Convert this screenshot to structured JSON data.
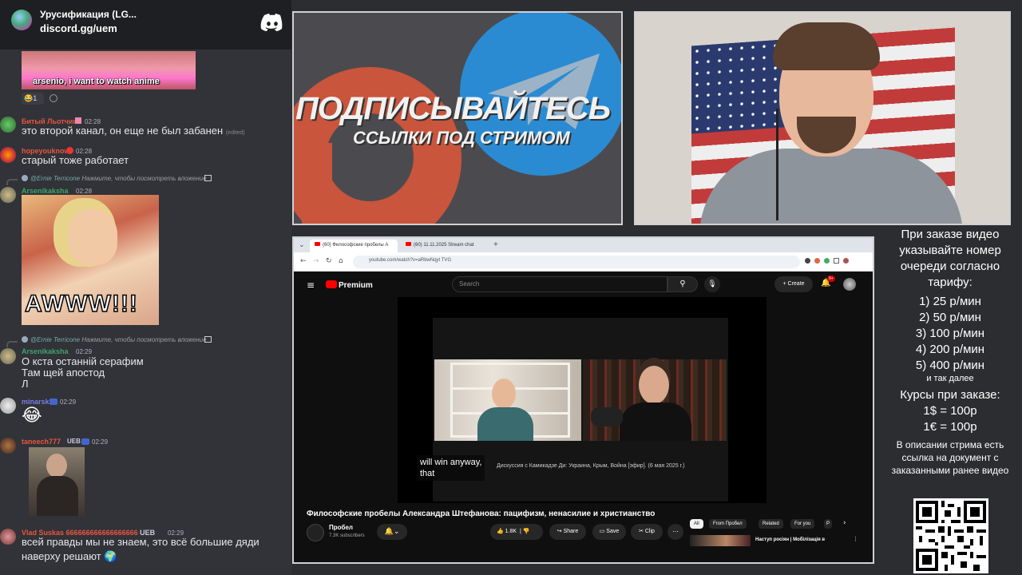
{
  "chat": {
    "server_name": "Урусификация (LG...",
    "server_link": "discord.gg/uem",
    "gif1_caption": "arsenio, i want to watch anime",
    "reaction_count": "1",
    "messages": [
      {
        "name": "Битый Льотчик",
        "time": "02:28",
        "text": "это второй канал, он еще не был забанен",
        "suffix": "(edited)"
      },
      {
        "name": "hopeyouknow",
        "time": "02:28",
        "text": "старый тоже работает"
      },
      {
        "reply": "@Ernie Terricone",
        "reply_text": "Нажмите, чтобы посмотреть вложение",
        "name": "Arsenikaksha",
        "time": "02:28",
        "gif_caption": "AWWW!!!"
      },
      {
        "reply": "@Ernie Terricone",
        "reply_text": "Нажмите, чтобы посмотреть вложение",
        "name": "Arsenikaksha",
        "time": "02:29",
        "lines": [
          "О кста останній серафим",
          "Там щей апостод",
          "Л"
        ]
      },
      {
        "name": "minarski",
        "time": "02:29",
        "emoji": "😂"
      },
      {
        "name": "taneech777",
        "badge": "UEB",
        "time": "02:29"
      },
      {
        "name": "Vlad Suskas",
        "extra": "666666666666666666",
        "badge": "UEB",
        "time": "02:29",
        "lines": [
          "всей правды мы не знаем, это всё большие дяди",
          "наверху решают"
        ]
      }
    ]
  },
  "promo": {
    "headline": "ПОДПИСЫВАЙТЕСЬ",
    "subline": "ССЫЛКИ ПОД СТРИМОМ"
  },
  "browser": {
    "tabs": [
      "(60) Философские пробелы А",
      "(60) 11.11.2025 Stream chat"
    ],
    "url": "youtube.com/watch?v=aRbwNqyt TVG",
    "yt_logo": "Premium",
    "search_placeholder": "Search",
    "create_label": "Create",
    "notif_count": "9+",
    "subtitle_line1": "will win anyway,",
    "subtitle_line2": "that",
    "video_caption": "Дискуссия с Камикадзе Ди: Украина, Крым, Война [эфир]. (6 мая 2025 г.)",
    "video_title": "Философские пробелы Александра Штефанова: пацифизм, ненасилие и христианство",
    "channel_name": "Пробел",
    "subscribers": "7.3K subscribers",
    "likes": "1.8K",
    "share_label": "Share",
    "save_label": "Save",
    "clip_label": "Clip",
    "chips": [
      "All",
      "From Пробел",
      "Related",
      "For you",
      "Р"
    ],
    "next_video_title": "Наступ росіян | Мобілізація в"
  },
  "info": {
    "intro": "При заказе видео указывайте номер очереди согласно тарифу:",
    "tariffs": [
      "1) 25 р/мин",
      "2) 50 р/мин",
      "3) 100 р/мин",
      "4) 200 р/мин",
      "5) 400 р/мин"
    ],
    "etc": "и так далее",
    "rates_title": "Курсы при заказе:",
    "rates": [
      "1$ = 100р",
      "1€ = 100р"
    ],
    "footer": "В описании стрима есть ссылка на документ с заказанными ранее видео"
  },
  "colors": {
    "discord_bg": "#313338",
    "discord_header": "#1e1f22",
    "name_red": "#e8553f",
    "name_green": "#3fa36b",
    "name_blue": "#7b7be8",
    "yt_red": "#ff0000"
  }
}
